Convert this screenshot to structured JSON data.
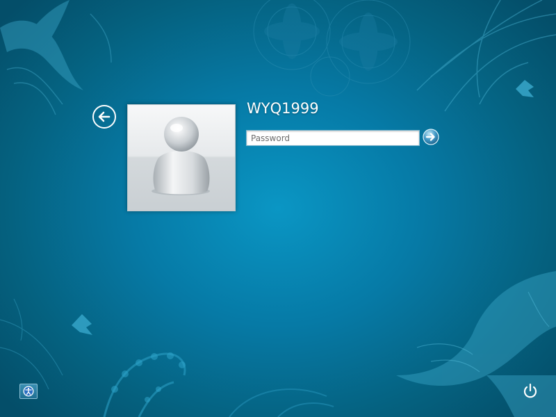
{
  "user": {
    "name": "WYQ1999"
  },
  "password": {
    "placeholder": "Password",
    "value": ""
  },
  "icons": {
    "back": "back-arrow-icon",
    "avatar": "user-avatar-icon",
    "submit": "submit-arrow-icon",
    "ease_of_access": "ease-of-access-icon",
    "power": "power-icon"
  },
  "colors": {
    "background_center": "#0a96c4",
    "background_edge": "#044e69",
    "text": "#ffffff"
  }
}
